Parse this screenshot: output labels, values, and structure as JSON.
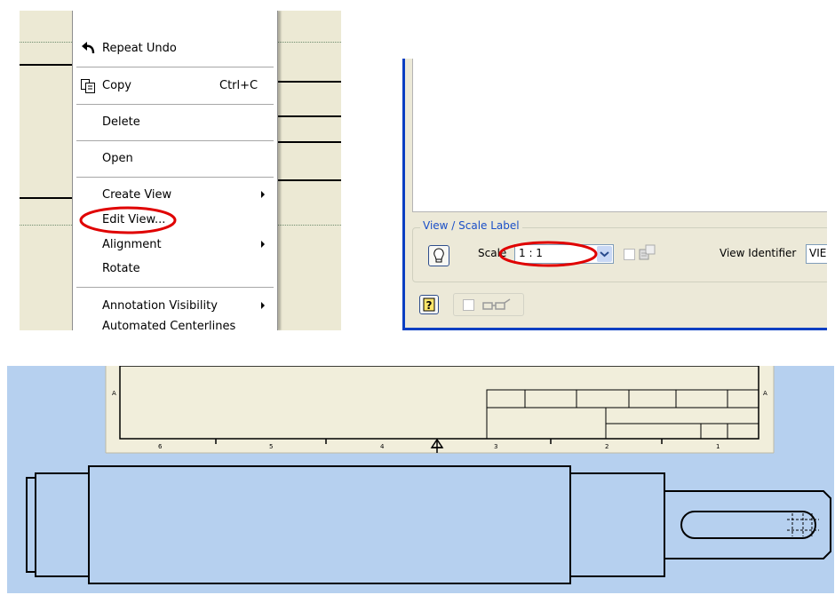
{
  "context_menu": {
    "items": [
      {
        "label": "Repeat Undo",
        "shortcut": "",
        "submenu": false,
        "icon": "undo-arrow-icon"
      },
      {
        "label": "Copy",
        "shortcut": "Ctrl+C",
        "submenu": false,
        "icon": "copy-icon"
      },
      {
        "label": "Delete",
        "shortcut": "",
        "submenu": false,
        "icon": ""
      },
      {
        "label": "Open",
        "shortcut": "",
        "submenu": false,
        "icon": ""
      },
      {
        "label": "Create View",
        "shortcut": "",
        "submenu": true,
        "icon": ""
      },
      {
        "label": "Edit View...",
        "shortcut": "",
        "submenu": false,
        "icon": ""
      },
      {
        "label": "Alignment",
        "shortcut": "",
        "submenu": true,
        "icon": ""
      },
      {
        "label": "Rotate",
        "shortcut": "",
        "submenu": false,
        "icon": ""
      },
      {
        "label": "Annotation Visibility",
        "shortcut": "",
        "submenu": true,
        "icon": ""
      },
      {
        "label": "Automated Centerlines",
        "shortcut": "",
        "submenu": false,
        "icon": ""
      }
    ],
    "highlighted_item": "Edit View..."
  },
  "dialog": {
    "group_title": "View / Scale Label",
    "scale_label": "Scale",
    "scale_value": "1 : 1",
    "view_identifier_label": "View Identifier",
    "view_identifier_value": "VIE",
    "highlighted_field": "scale",
    "accent_color": "#0a3fc2",
    "highlight_color": "#e00000"
  },
  "drawing": {
    "background_color": "#b6d0ef",
    "sheet_color": "#f1eedb",
    "border_zone_numbers": [
      "6",
      "5",
      "4",
      "3",
      "2",
      "1"
    ],
    "border_row_letter": "A"
  }
}
